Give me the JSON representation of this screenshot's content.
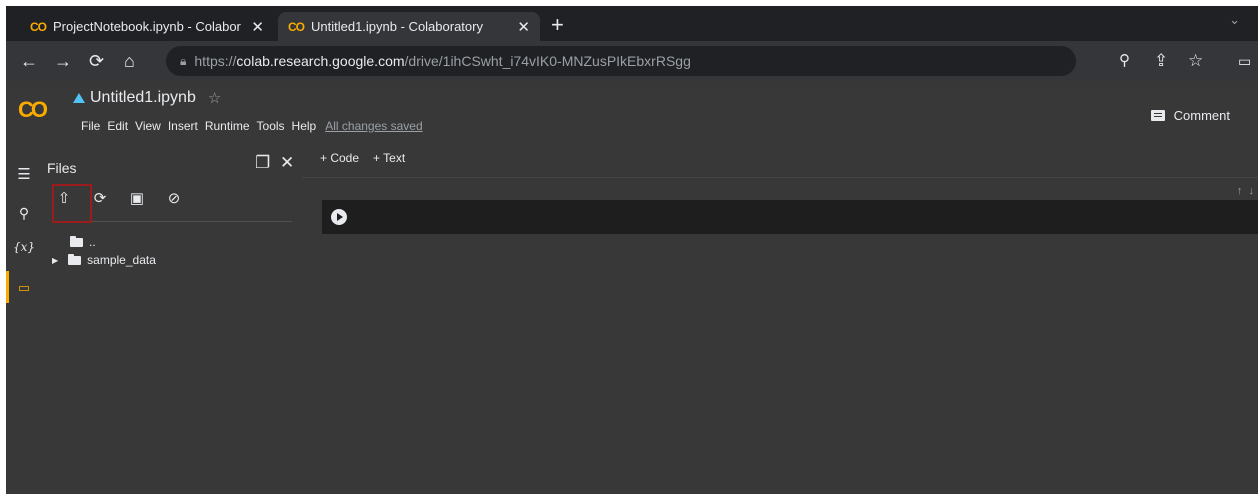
{
  "browser": {
    "tabs": [
      {
        "logo": "CO",
        "title": "ProjectNotebook.ipynb - Colabor",
        "close": "✕"
      },
      {
        "logo": "CO",
        "title": "Untitled1.ipynb - Colaboratory",
        "close": "✕"
      }
    ],
    "new_tab": "+",
    "tab_menu": "⌄",
    "url": {
      "scheme": "https://",
      "host": "colab.research.google.com",
      "path": "/drive/1ihCSwht_i74vIK0-MNZusPIkEbxrRSgg"
    }
  },
  "colab": {
    "logo": "CO",
    "file_name": "Untitled1.ipynb",
    "star": "☆",
    "menu": [
      "File",
      "Edit",
      "View",
      "Insert",
      "Runtime",
      "Tools",
      "Help"
    ],
    "save_status": "All changes saved",
    "comment_label": "Comment"
  },
  "sidebar": {
    "title": "Files",
    "tree": [
      {
        "name": ".."
      },
      {
        "name": "sample_data"
      }
    ]
  },
  "notebook": {
    "add_code": "+ Code",
    "add_text": "+ Text"
  },
  "colors": {
    "accent": "#f9ab00",
    "highlight": "#9b1c1c"
  }
}
